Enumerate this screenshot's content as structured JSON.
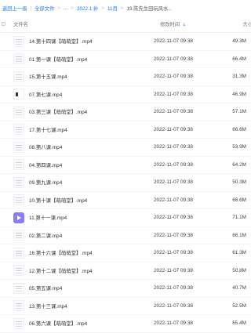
{
  "breadcrumb": {
    "back": "返回上一级",
    "all_files": "全部文件",
    "ellipsis": "...",
    "year": "2022.1 补",
    "month": "11月",
    "current": "19.陈先生田玩风水..."
  },
  "header": {
    "name": "文件名",
    "modified": "修改时间",
    "size": "大小"
  },
  "rows": [
    {
      "name": "14.第十四课【萌萌堂】.mp4",
      "time": "2022-11-07 09:38",
      "size": "49.3M",
      "thumb": "doc"
    },
    {
      "name": "01.第一课【萌萌堂】.mp4",
      "time": "2022-11-07 09:38",
      "size": "66.4M",
      "thumb": "doc"
    },
    {
      "name": "15.第十五课.mp4",
      "time": "2022-11-07 09:38",
      "size": "31.3M",
      "thumb": "doc"
    },
    {
      "name": "07.第七课.mp4",
      "time": "2022-11-07 09:38",
      "size": "46.9M",
      "thumb": "dark"
    },
    {
      "name": "03.第三课【萌萌堂】.mp4",
      "time": "2022-11-07 09:38",
      "size": "57.1M",
      "thumb": "doc"
    },
    {
      "name": "17.第十七课.mp4",
      "time": "2022-11-07 09:38",
      "size": "66.6M",
      "thumb": "doc"
    },
    {
      "name": "08.第八课.mp4",
      "time": "2022-11-07 09:38",
      "size": "53.9M",
      "thumb": "doc"
    },
    {
      "name": "04.第四课.mp4",
      "time": "2022-11-07 09:38",
      "size": "64.2M",
      "thumb": "doc"
    },
    {
      "name": "09.第九课.mp4",
      "time": "2022-11-07 09:38",
      "size": "50.3M",
      "thumb": "doc"
    },
    {
      "name": "10.第十课【萌萌堂】.mp4",
      "time": "2022-11-07 09:38",
      "size": "68.6M",
      "thumb": "doc"
    },
    {
      "name": "11.第十一课.mp4",
      "time": "2022-11-07 09:38",
      "size": "71.1M",
      "thumb": "video"
    },
    {
      "name": "02.第二课.mp4",
      "time": "2022-11-07 09:38",
      "size": "66.1M",
      "thumb": "doc"
    },
    {
      "name": "16.第十六课【萌萌堂】.mp4",
      "time": "2022-11-07 09:38",
      "size": "61.3M",
      "thumb": "doc"
    },
    {
      "name": "12.第十二课【萌萌堂】.mp4",
      "time": "2022-11-07 09:38",
      "size": "50.8M",
      "thumb": "doc"
    },
    {
      "name": "05.第五课.mp4",
      "time": "2022-11-07 09:38",
      "size": "40.7M",
      "thumb": "doc"
    },
    {
      "name": "13.第十三课.mp4",
      "time": "2022-11-07 09:38",
      "size": "52.5M",
      "thumb": "doc"
    },
    {
      "name": "06.第六课【萌萌堂】.mp4",
      "time": "2022-11-07 09:38",
      "size": "65.4M",
      "thumb": "doc"
    }
  ]
}
